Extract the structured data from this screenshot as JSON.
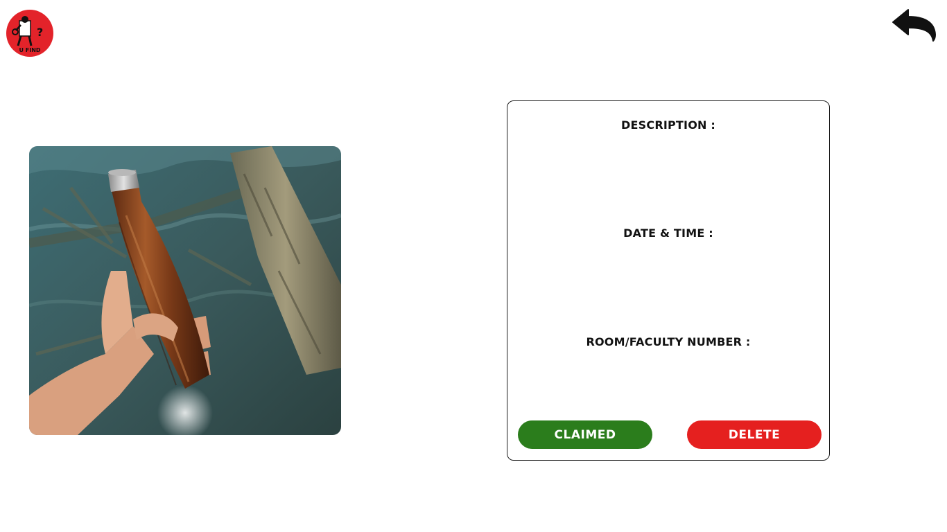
{
  "logo": {
    "text": "U FIND",
    "mark": "?",
    "color": "#e3232a"
  },
  "nav": {
    "back_icon": "back-arrow-icon"
  },
  "item_photo": {
    "subject": "hand holding wood-grain insulated water bottle over clear water"
  },
  "details": {
    "description_label": "DESCRIPTION :",
    "datetime_label": "DATE & TIME :",
    "room_label": "ROOM/FACULTY NUMBER :"
  },
  "actions": {
    "claimed_label": "CLAIMED",
    "claimed_color": "#2b7d1c",
    "delete_label": "DELETE",
    "delete_color": "#e5201f"
  }
}
